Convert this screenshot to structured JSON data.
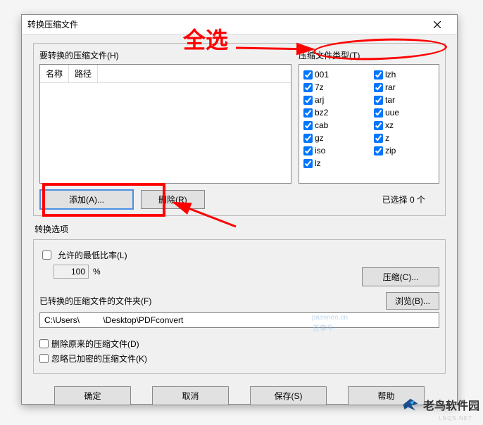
{
  "dialog": {
    "title": "转换压缩文件"
  },
  "annotations": {
    "select_all": "全选"
  },
  "sections": {
    "files_to_convert": "要转换的压缩文件(H)",
    "archive_types": "压缩文件类型(T)",
    "filelist_cols": {
      "name": "名称",
      "path": "路径"
    },
    "selected_count": "已选择 0 个",
    "conv_options": "转换选项",
    "allow_min_ratio": "允许的最低比率(L)",
    "ratio_value": "100",
    "percent": "%",
    "converted_folder": "已转换的压缩文件的文件夹(F)",
    "folder_path": "C:\\Users\\          \\Desktop\\PDFconvert",
    "delete_original": "删除原来的压缩文件(D)",
    "skip_encrypted": "忽略已加密的压缩文件(K)"
  },
  "types": {
    "col1": [
      "001",
      "7z",
      "arj",
      "bz2",
      "cab",
      "gz",
      "iso",
      "lz",
      "lzh"
    ],
    "col2": [
      "rar",
      "tar",
      "uue",
      "xz",
      "z",
      "zip"
    ]
  },
  "buttons": {
    "add": "添加(A)...",
    "remove": "删除(R)",
    "compress": "压缩(C)...",
    "browse": "浏览(B)...",
    "ok": "确定",
    "cancel": "取消",
    "save": "保存(S)",
    "help": "帮助"
  },
  "watermark": {
    "w1": "passneo.cn",
    "w2": "百事牛"
  },
  "logo": {
    "text": "老鸟软件园",
    "sub": "LNQS.NET"
  }
}
